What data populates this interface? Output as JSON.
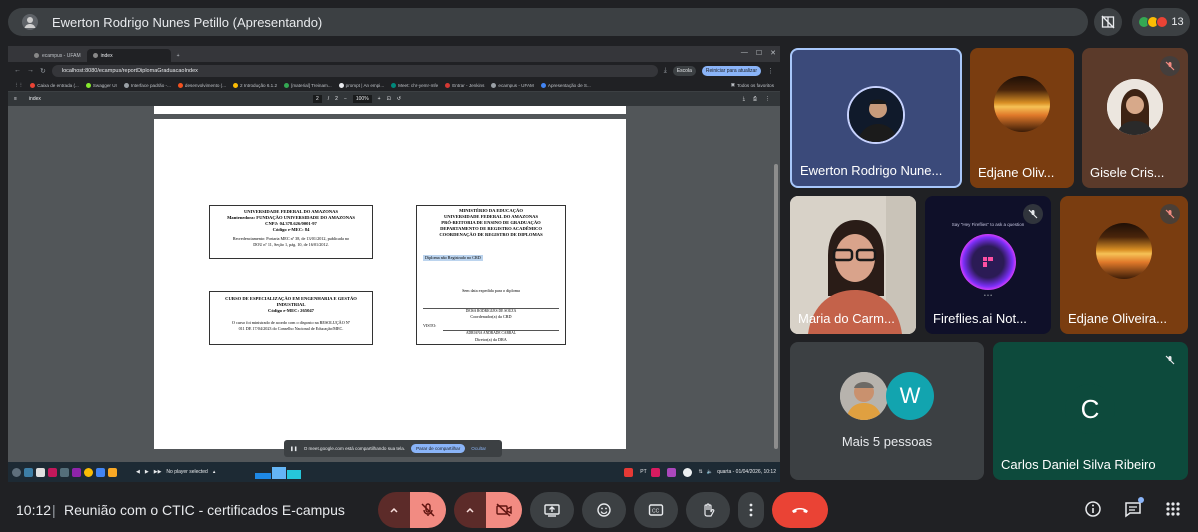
{
  "presenter": {
    "title": "Ewerton Rodrigo Nunes Petillo (Apresentando)"
  },
  "top_right": {
    "people_count": "13"
  },
  "browser": {
    "tabs": [
      {
        "label": "ecampus - UFAM"
      },
      {
        "label": "index"
      }
    ],
    "new_tab": "+",
    "url": "localhost:8080/ecampus/reportDiplomaGraduacaoIndex",
    "profile": "Escola",
    "reload_notice": "Reiniciar para atualizar",
    "bookmarks": [
      "Caixa de entrada (...",
      "Swagger UI",
      "Interface padrão -...",
      "desenvolvimento (...",
      "2 Introdução 6.1.2",
      "[material] Treinam...",
      "prompt | An empi...",
      "Meet: chr-yemr-mfe",
      "Entrar - Jenkins",
      "ecampus - UFAM",
      "Apresentação de S..."
    ],
    "all_favorites": "Todos os favoritos"
  },
  "pdf": {
    "title": "index",
    "page_current": "2",
    "page_sep": "/",
    "page_total": "2",
    "zoom": "100%"
  },
  "diploma": {
    "univ_box": {
      "l1": "UNIVERSIDADE FEDERAL DO AMAZONAS",
      "l2": "Mantenedora: FUNDAÇÃO UNIVERSIDADE DO AMAZONAS",
      "l3": "CNPJ: 04.378.626/0001-97",
      "l4": "Código e-MEC: 84",
      "l5": "Recredenciamento: Portaria MEC nº 38, de 13/01/2012, publicada no",
      "l6": "DOU nº 11, Seção 1, pág. 10, de 16/01/2012."
    },
    "course_box": {
      "l1": "CURSO DE ESPECIALIZAÇÃO EM ENGENHARIA E GESTÃO",
      "l2": "INDUSTRIAL",
      "l3": "Código e-MEC: 265047",
      "l4": "O curso foi ministrado de acordo com o disposto na RESOLUÇÃO Nº",
      "l5": "011 DE 17/04/2023 do Conselho Nacional de Educação/MEC."
    },
    "ministry_box": {
      "l1": "MINISTÉRIO DA EDUCAÇÃO",
      "l2": "UNIVERSIDADE FEDERAL DO AMAZONAS",
      "l3": "PRÓ-REITORIA DE ENSINO DE GRADUAÇÃO",
      "l4": "DEPARTAMENTO DE REGISTRO ACADÊMICO",
      "l5": "COORDENAÇÃO DE REGISTRO DE DIPLOMAS",
      "highlight": "Diploma não Registrado no CRD",
      "no_date": "Sem data expedida para o diploma",
      "signer1": "DEISA RODRIGUES DE SOUZA",
      "role1": "Coordenador(a) da CRD",
      "visto": "VISTO:",
      "signer2": "ADRIANA ANDRADE CABRAL",
      "role2": "Diretor(a) da DRA"
    }
  },
  "share_banner": {
    "text": "O meet.google.com está compartilhando sua tela.",
    "stop": "Parar de compartilhar",
    "hide": "Ocultar"
  },
  "taskbar": {
    "player": "No player selected",
    "lang": "PT",
    "datetime": "quarta - 01/04/2026, 10:12"
  },
  "tiles": [
    {
      "name": "Ewerton Rodrigo Nune..."
    },
    {
      "name": "Edjane Oliv..."
    },
    {
      "name": "Gisele Cris..."
    },
    {
      "name": "Maria do Carm..."
    },
    {
      "name": "Fireflies.ai Not...",
      "caption": "Say \"Hey Fireflies\" to ask a question",
      "dots": "• • •"
    },
    {
      "name": "Edjane Oliveira..."
    },
    {
      "name": "Mais 5 pessoas",
      "initial": "W"
    },
    {
      "name": "Carlos Daniel Silva Ribeiro",
      "initial": "C"
    }
  ],
  "bottom": {
    "time": "10:12",
    "separator": "|",
    "meeting": "Reunião com o CTIC - certificados E-campus"
  },
  "colors": {
    "bg": "#202124",
    "hangup": "#ea4335",
    "mic_off": "#f28b82",
    "carlos_tile": "#0d4a3c",
    "avatar_w": "#12a4af"
  }
}
